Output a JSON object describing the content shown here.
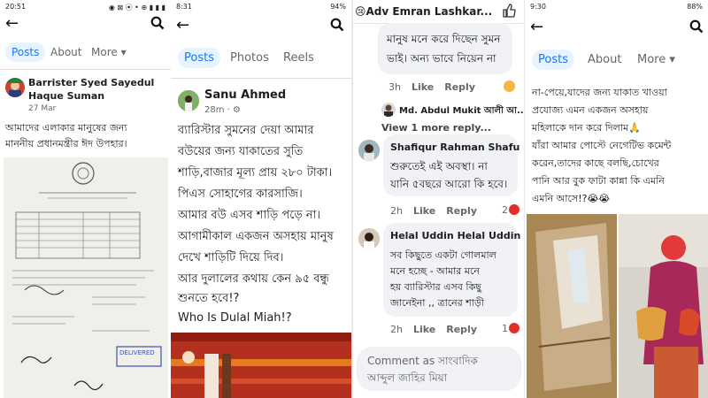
{
  "panel1": {
    "status_time": "20:51",
    "status_icons": "◉ ⊠ ⦿ • ⊕ ▮ ▮ ▮",
    "tabs": [
      "Posts",
      "About",
      "More ▾"
    ],
    "author": "Barrister Syed Sayedul Haque Suman",
    "author_line1": "Barrister Syed Sayedul",
    "author_line2": "Haque Suman",
    "date": "27 Mar",
    "post_line1": "আমাদের এলাকার মানুষের জন্য",
    "post_line2": "মাননীয় প্রধানমন্ত্রীর ঈদ উপহার।",
    "stamp_text": "DELIVERED"
  },
  "panel2": {
    "status_time": "8:31",
    "status_battery": "94%",
    "tabs": [
      "Posts",
      "Photos",
      "Reels"
    ],
    "author": "Sanu Ahmed",
    "time": "28m · ⚙",
    "post_lines": [
      "ব্যারিস্টার সুমনের দেয়া আমার",
      "বউয়ের জন্য যাকাতের সুতি",
      "শাড়ি,বাজার মূল্য প্রায় ২৮০ টাকা।",
      "পিএস সোহাগের কারসাজি।",
      "আমার বউ এসব শাড়ি পড়ে না।",
      "আগামীকাল একজন অসহায় মানুষ",
      "দেখে শাড়িটি দিয়ে দিব।",
      "আর দুলালের কথায় কেন ৯৫ বন্ধু",
      "শুনতে হবে!?",
      "Who Is Dulal Miah!?"
    ]
  },
  "panel3": {
    "header_title": "😢Adv Emran Lashkar...",
    "comment0_lines": [
      "মানুষ মনে করে দিছেন সুমন",
      "ভাই। অন্য ভাবে নিয়েন না"
    ],
    "comment0_time": "3h",
    "reply_from": "Md. Abdul Mukit আলী আ...",
    "view_replies": "View 1 more reply...",
    "comments": [
      {
        "name": "Shafiqur Rahman Shafu",
        "lines": [
          "শুরুতেই এই অবস্থা। না",
          "যানি ৫বছরে আরো কি হবে।"
        ],
        "time": "2h",
        "count": "2"
      },
      {
        "name": "Helal Uddin Helal Uddin",
        "lines": [
          "সব কিছুতে একটা গোলমাল",
          "মনে হচ্ছে  -  আমার মনে",
          "হয় ব্যারিস্টার এসব কিছু",
          "জানেইনা  ,,  ত্রানের শাড়ী"
        ],
        "time": "2h",
        "count": "1"
      }
    ],
    "like_label": "Like",
    "reply_label": "Reply",
    "comment_as_line1": "Comment as সাংবাদিক",
    "comment_as_line2": "আব্দুল জাহির মিয়া"
  },
  "panel4": {
    "status_time": "9:30",
    "status_battery": "88%",
    "tabs": [
      "Posts",
      "About",
      "More ▾"
    ],
    "post_lines": [
      "না-পেয়ে,যাদের জন্য যাকাত খাওয়া",
      "প্রযোজ্য এমন একজন অসহায়",
      "মহিলাকে দান করে দিলাম🙏",
      "যাঁরা আমার পোস্টে নেগেটিভ কমেন্ট",
      "করেন,তাদের কাছে বলছি,চোখের",
      "পানি আর বুক ফাটা কান্না কি এমনি",
      "এমনি আসে!?😭😭"
    ]
  },
  "colors": {
    "accent": "#1877f2",
    "tab_bg": "#e7f3ff",
    "bubble": "#f0f2f5",
    "muted": "#65676b",
    "red": "#e0302a"
  }
}
